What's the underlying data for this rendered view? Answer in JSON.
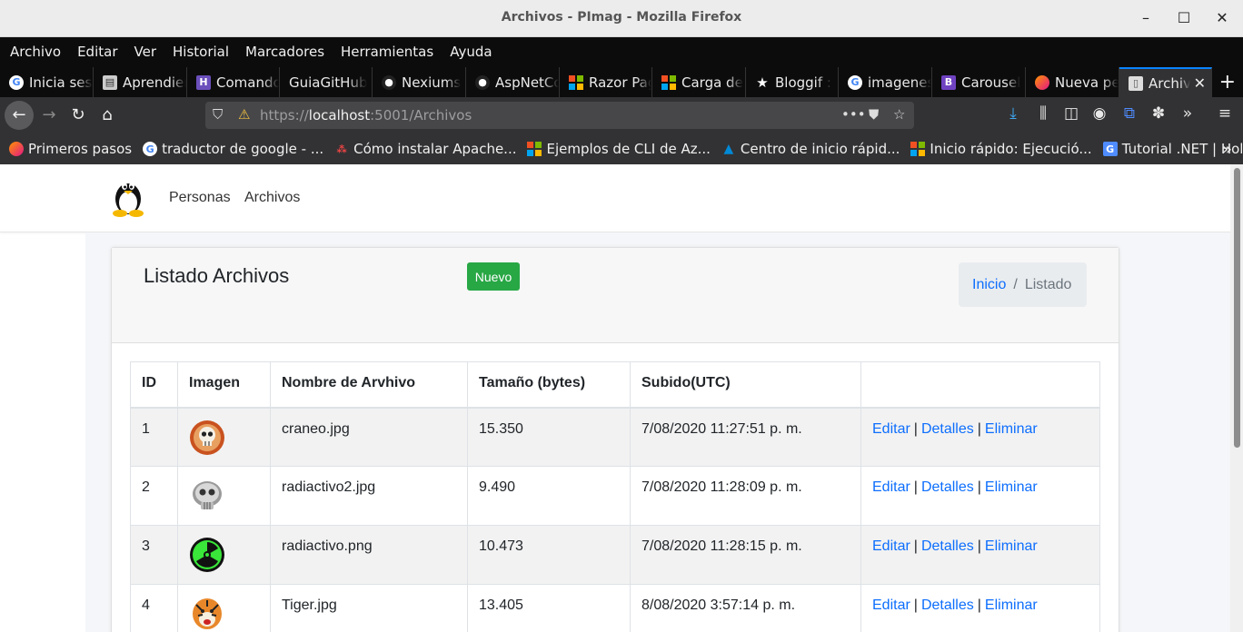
{
  "window": {
    "title": "Archivos - PImag - Mozilla Firefox"
  },
  "menu": [
    "Archivo",
    "Editar",
    "Ver",
    "Historial",
    "Marcadores",
    "Herramientas",
    "Ayuda"
  ],
  "tabs": [
    {
      "label": "Inicia sesión",
      "icon": "google-icon"
    },
    {
      "label": "Aprendiendo",
      "icon": "book-icon"
    },
    {
      "label": "Comandos",
      "icon": "h-icon"
    },
    {
      "label": "GuiaGitHub",
      "icon": ""
    },
    {
      "label": "Nexiums",
      "icon": "github-icon"
    },
    {
      "label": "AspNetCore",
      "icon": "github-icon"
    },
    {
      "label": "Razor Pages",
      "icon": "microsoft-icon"
    },
    {
      "label": "Carga de",
      "icon": "microsoft-icon"
    },
    {
      "label": "Bloggif :",
      "icon": "star-icon"
    },
    {
      "label": "imagenes",
      "icon": "google-icon"
    },
    {
      "label": "Carousel",
      "icon": "bootstrap-icon"
    },
    {
      "label": "Nueva pestaña",
      "icon": "firefox-icon"
    },
    {
      "label": "Archivos",
      "icon": "page-icon"
    }
  ],
  "address": {
    "prefix": "https://",
    "host": "localhost",
    "rest": ":5001/Archivos"
  },
  "bookmarks": [
    {
      "label": "Primeros pasos",
      "icon": "firefox-icon"
    },
    {
      "label": "traductor de google - ...",
      "icon": "google-icon"
    },
    {
      "label": "Cómo instalar Apache...",
      "icon": "dots-icon"
    },
    {
      "label": "Ejemplos de CLI de Az...",
      "icon": "microsoft-icon"
    },
    {
      "label": "Centro de inicio rápid...",
      "icon": "azure-icon"
    },
    {
      "label": "Inicio rápido: Ejecució...",
      "icon": "microsoft-icon"
    },
    {
      "label": "Tutorial .NET | Hola ...",
      "icon": "translate-icon"
    }
  ],
  "site_nav": {
    "links": [
      "Personas",
      "Archivos"
    ]
  },
  "card": {
    "title": "Listado Archivos",
    "new_button": "Nuevo",
    "breadcrumb": {
      "home": "Inicio",
      "separator": "/",
      "current": "Listado"
    }
  },
  "table": {
    "headers": [
      "ID",
      "Imagen",
      "Nombre de Arvhivo",
      "Tamaño (bytes)",
      "Subido(UTC)",
      ""
    ],
    "rows": [
      {
        "id": "1",
        "image": "skull-red",
        "name": "craneo.jpg",
        "size": "15.350",
        "date": "7/08/2020 11:27:51 p. m."
      },
      {
        "id": "2",
        "image": "skull-gray",
        "name": "radiactivo2.jpg",
        "size": "9.490",
        "date": "7/08/2020 11:28:09 p. m."
      },
      {
        "id": "3",
        "image": "radioactive-green",
        "name": "radiactivo.png",
        "size": "10.473",
        "date": "7/08/2020 11:28:15 p. m."
      },
      {
        "id": "4",
        "image": "tiger",
        "name": "Tiger.jpg",
        "size": "13.405",
        "date": "8/08/2020 3:57:14 p. m."
      }
    ],
    "actions": {
      "edit": "Editar",
      "details": "Detalles",
      "delete": "Eliminar",
      "separator": "|"
    }
  }
}
